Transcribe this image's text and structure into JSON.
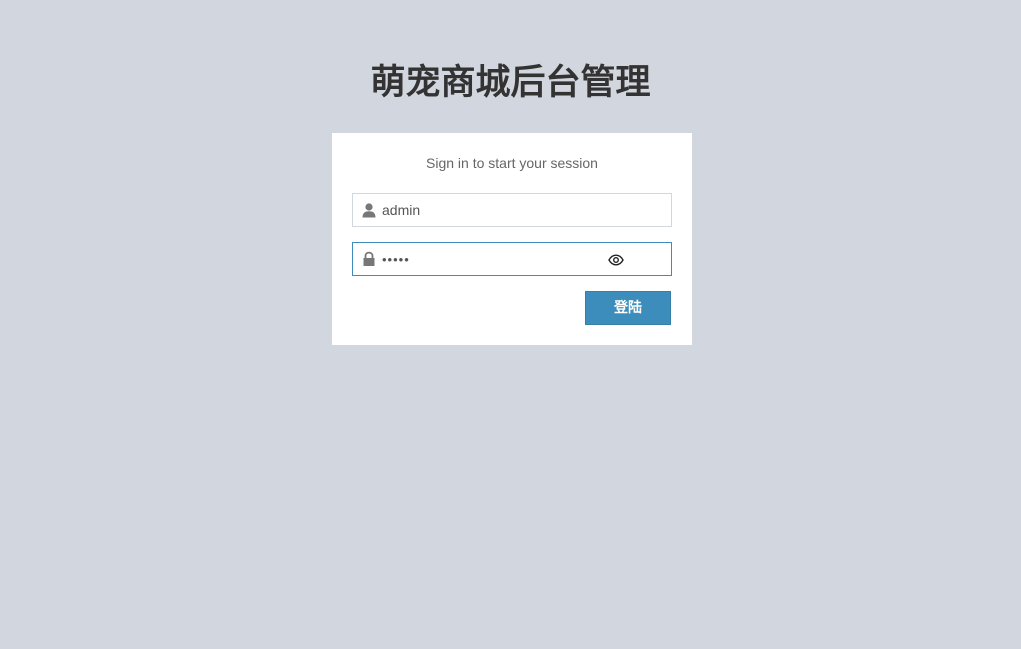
{
  "page": {
    "logo_text": "萌宠商城后台管理"
  },
  "login_box": {
    "message": "Sign in to start your session",
    "username": {
      "value": "admin",
      "icon": "user-icon"
    },
    "password": {
      "value": "admin",
      "icon": "lock-icon",
      "toggle_icon": "eye-icon"
    },
    "submit_label": "登陆"
  },
  "colors": {
    "background": "#d2d6de",
    "accent": "#3c8dbc",
    "box": "#ffffff"
  }
}
